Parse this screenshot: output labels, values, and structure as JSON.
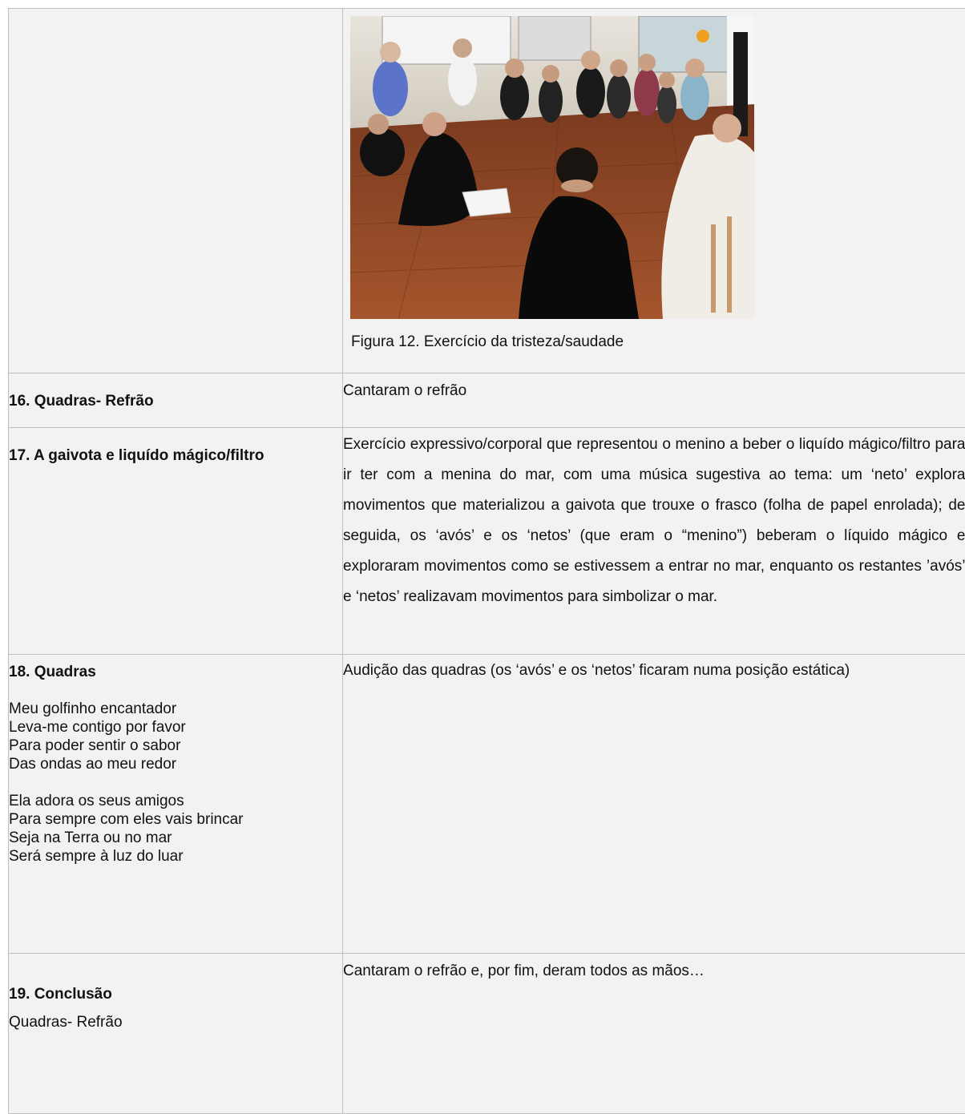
{
  "figure": {
    "caption": "Figura 12. Exercício da tristeza/saudade"
  },
  "rows": [
    {
      "title": "16. Quadras- Refrão",
      "description": "Cantaram o refrão"
    },
    {
      "title": "17. A gaivota e liquído mágico/filtro",
      "description": "Exercício expressivo/corporal que representou o menino a beber o liquído mágico/filtro para ir ter com a menina do mar, com uma música sugestiva ao tema: um ‘neto’ explora movimentos que materializou a gaivota que trouxe o frasco (folha de papel enrolada); de seguida, os ‘avós’ e os ‘netos’ (que eram o “menino”) beberam o líquido mágico e exploraram movimentos como se estivessem a entrar no mar, enquanto os restantes ’avós’ e ‘netos’ realizavam movimentos para simbolizar o mar."
    },
    {
      "title": "18. Quadras",
      "stanza1": [
        "Meu golfinho encantador",
        "Leva-me contigo por favor",
        "Para poder sentir o sabor",
        "Das ondas ao meu redor"
      ],
      "stanza2": [
        "Ela adora os seus amigos",
        "Para sempre com eles vais brincar",
        "Seja na Terra ou no mar",
        "Será sempre à luz do luar"
      ],
      "description": "Audição das quadras (os ‘avós’ e os ‘netos’ ficaram numa posição estática)"
    },
    {
      "title": "19. Conclusão",
      "subtitle": "Quadras- Refrão",
      "description": "Cantaram o refrão e, por fim, deram todos as mãos…"
    }
  ]
}
